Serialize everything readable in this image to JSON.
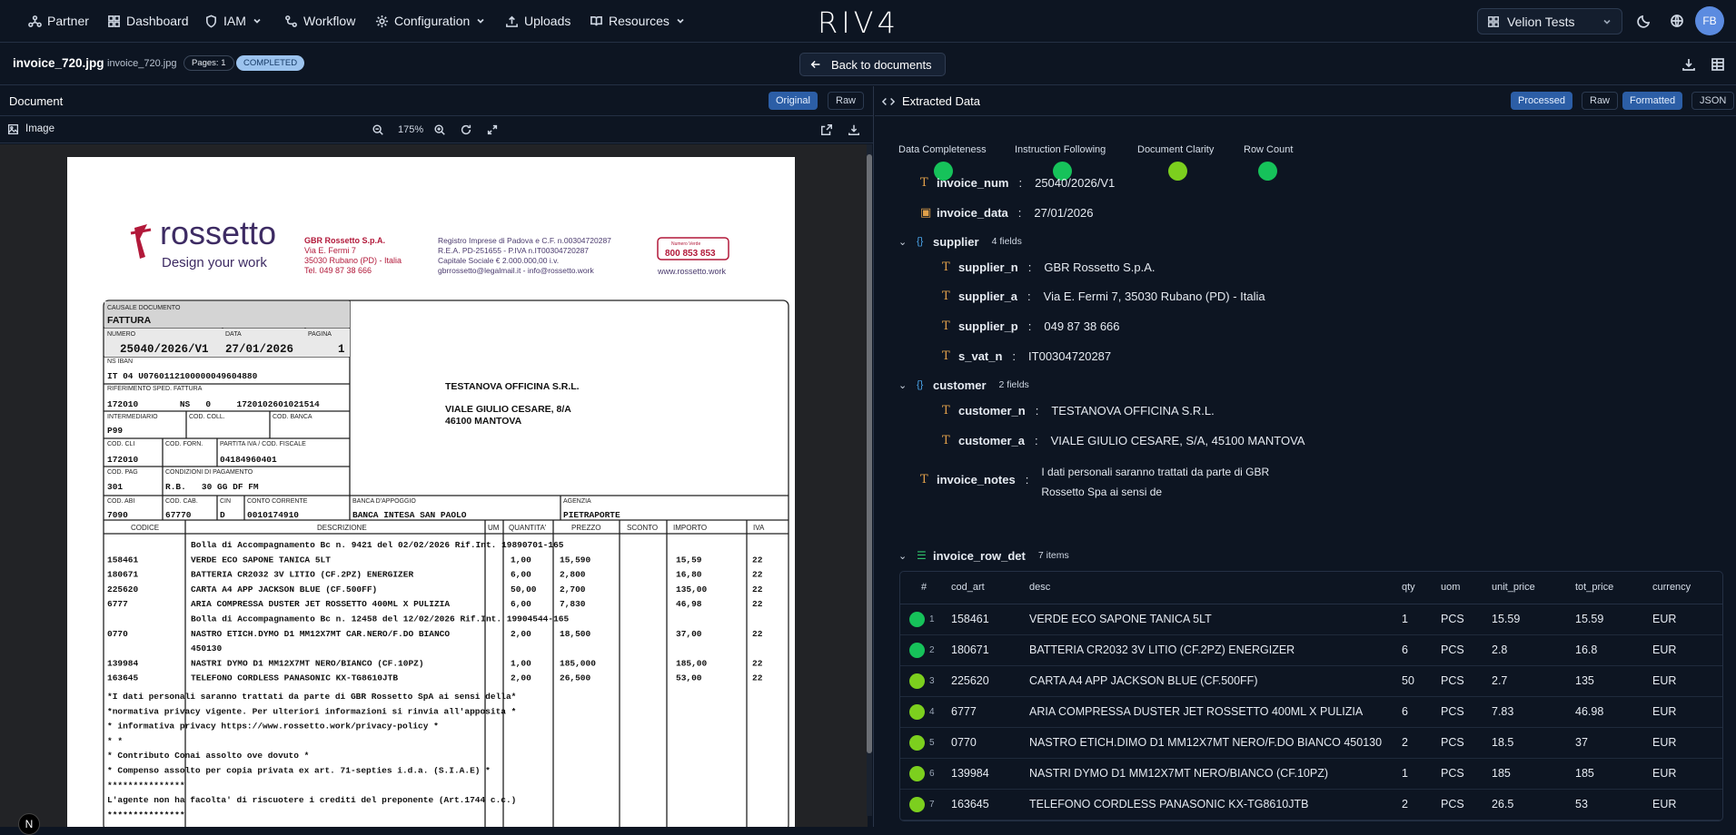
{
  "nav": {
    "items": [
      {
        "label": "Partner",
        "icon": "partner-icon",
        "has_dropdown": false
      },
      {
        "label": "Dashboard",
        "icon": "dashboard-icon",
        "has_dropdown": false
      },
      {
        "label": "IAM",
        "icon": "shield-icon",
        "has_dropdown": true
      },
      {
        "label": "Workflow",
        "icon": "workflow-icon",
        "has_dropdown": false
      },
      {
        "label": "Configuration",
        "icon": "gear-icon",
        "has_dropdown": true
      },
      {
        "label": "Uploads",
        "icon": "upload-icon",
        "has_dropdown": false
      },
      {
        "label": "Resources",
        "icon": "book-icon",
        "has_dropdown": true
      }
    ],
    "logo": "RIV4",
    "workspace": "Velion Tests",
    "avatar": "FB"
  },
  "doc": {
    "file_name": "invoice_720.jpg",
    "file_name_small": "invoice_720.jpg",
    "pages": "Pages: 1",
    "status": "COMPLETED",
    "back": "Back to documents"
  },
  "left": {
    "title": "Document",
    "toggles": [
      "Original",
      "Raw"
    ],
    "image_label": "Image",
    "zoom": "175%"
  },
  "right": {
    "title": "Extracted Data",
    "toggles_a": [
      "Processed",
      "Raw"
    ],
    "toggles_b": [
      "Formatted",
      "JSON"
    ],
    "scores": [
      {
        "label": "Data Completeness",
        "color": "#16c25a"
      },
      {
        "label": "Instruction Following",
        "color": "#16c25a"
      },
      {
        "label": "Document Clarity",
        "color": "#7ccf1e"
      },
      {
        "label": "Row Count",
        "color": "#16c25a"
      }
    ],
    "fields": {
      "invoice_num": {
        "k": "invoice_num",
        "v": "25040/2026/V1"
      },
      "invoice_data": {
        "k": "invoice_data",
        "v": "27/01/2026"
      },
      "supplier": {
        "k": "supplier",
        "count": "4 fields"
      },
      "supplier_n": {
        "k": "supplier_n",
        "v": "GBR Rossetto S.p.A."
      },
      "supplier_a": {
        "k": "supplier_a",
        "v": "Via E. Fermi 7, 35030 Rubano (PD) - Italia"
      },
      "supplier_p": {
        "k": "supplier_p",
        "v": "049 87 38 666"
      },
      "s_vat_n": {
        "k": "s_vat_n",
        "v": "IT00304720287"
      },
      "customer": {
        "k": "customer",
        "count": "2 fields"
      },
      "customer_n": {
        "k": "customer_n",
        "v": "TESTANOVA OFFICINA S.R.L."
      },
      "customer_a": {
        "k": "customer_a",
        "v": "VIALE GIULIO CESARE, S/A, 45100 MANTOVA"
      },
      "invoice_notes": {
        "k": "invoice_notes",
        "v1": "I dati personali saranno trattati da parte di GBR",
        "v2": "Rossetto Spa ai sensi de"
      },
      "rows": {
        "k": "invoice_row_det",
        "count": "7 items"
      }
    },
    "table": {
      "headers": [
        "#",
        "cod_art",
        "desc",
        "qty",
        "uom",
        "unit_price",
        "tot_price",
        "currency"
      ],
      "rows": [
        {
          "n": "1",
          "dot": "#16c25a",
          "cod": "158461",
          "desc": "VERDE ECO SAPONE TANICA 5LT",
          "qty": "1",
          "uom": "PCS",
          "up": "15.59",
          "tp": "15.59",
          "cur": "EUR"
        },
        {
          "n": "2",
          "dot": "#16c25a",
          "cod": "180671",
          "desc": "BATTERIA CR2032 3V LITIO (CF.2PZ) ENERGIZER",
          "qty": "6",
          "uom": "PCS",
          "up": "2.8",
          "tp": "16.8",
          "cur": "EUR"
        },
        {
          "n": "3",
          "dot": "#7ccf1e",
          "cod": "225620",
          "desc": "CARTA A4 APP JACKSON BLUE (CF.500FF)",
          "qty": "50",
          "uom": "PCS",
          "up": "2.7",
          "tp": "135",
          "cur": "EUR"
        },
        {
          "n": "4",
          "dot": "#7ccf1e",
          "cod": "6777",
          "desc": "ARIA COMPRESSA DUSTER JET ROSSETTO 400ML X PULIZIA",
          "qty": "6",
          "uom": "PCS",
          "up": "7.83",
          "tp": "46.98",
          "cur": "EUR"
        },
        {
          "n": "5",
          "dot": "#7ccf1e",
          "cod": "0770",
          "desc": "NASTRO ETICH.DIMO D1 MM12X7MT NERO/F.DO BIANCO 450130",
          "qty": "2",
          "uom": "PCS",
          "up": "18.5",
          "tp": "37",
          "cur": "EUR"
        },
        {
          "n": "6",
          "dot": "#7ccf1e",
          "cod": "139984",
          "desc": "NASTRI DYMO D1 MM12X7MT NERO/BIANCO (CF.10PZ)",
          "qty": "1",
          "uom": "PCS",
          "up": "185",
          "tp": "185",
          "cur": "EUR"
        },
        {
          "n": "7",
          "dot": "#7ccf1e",
          "cod": "163645",
          "desc": "TELEFONO CORDLESS PANASONIC KX-TG8610JTB",
          "qty": "2",
          "uom": "PCS",
          "up": "26.5",
          "tp": "53",
          "cur": "EUR"
        }
      ]
    }
  },
  "invoice_image": {
    "brand": "rossetto",
    "tagline": "Design your work",
    "company_block": [
      "GBR Rossetto S.p.A.",
      "Via E. Fermi 7",
      "35030 Rubano (PD) - Italia",
      "Tel. 049 87 38 666"
    ],
    "registry_block": [
      "Registro Imprese di Padova e C.F. n.00304720287",
      "R.E.A. PD-251655 - P.IVA n.IT00304720287",
      "Capitale Sociale € 2.000.000,00 i.v.",
      "gbrrossetto@legalmail.it - info@rossetto.work"
    ],
    "green_number_label": "Numero Verde",
    "green_number": "800 853 853",
    "website": "www.rossetto.work",
    "causale_label": "CAUSALE DOCUMENTO",
    "causale": "FATTURA",
    "numero_label": "NUMERO",
    "numero": "25040/2026/V1",
    "data_label": "DATA",
    "data": "27/01/2026",
    "pagina_label": "PAGINA",
    "pagina": "1",
    "iban_label": "NS IBAN",
    "iban": "IT 04 U0760112100000049604880",
    "rif_label": "RIFERIMENTO SPED. FATTURA",
    "rif": "172010        NS   0     1720102601021514",
    "intermediario_label": "INTERMEDIARIO",
    "intermediario": "P99",
    "cod_coll_label": "COD. COLL.",
    "cod_banca_label": "COD. BANCA",
    "cod_cli_label": "COD. CLI",
    "cod_cli": "172010",
    "cod_forn_label": "COD. FORN.",
    "piva_label": "PARTITA IVA / COD. FISCALE",
    "piva": "04184960401",
    "cod_pag_label": "COD. PAG",
    "cod_pag": "301",
    "cond_label": "CONDIZIONI DI PAGAMENTO",
    "cond": "R.B.   30 GG DF FM",
    "customer_name": "TESTANOVA OFFICINA S.R.L.",
    "customer_addr1": "VIALE GIULIO CESARE, 8/A",
    "customer_addr2": "46100 MANTOVA",
    "abi_label": "COD. ABI",
    "abi": "7090",
    "cab_label": "COD. CAB.",
    "cab": "67770",
    "cin_label": "CIN",
    "cin": "D",
    "cc_label": "CONTO CORRENTE",
    "cc": "0010174910",
    "banca_label": "BANCA D'APPOGGIO",
    "banca": "BANCA INTESA SAN PAOLO",
    "agenzia_label": "AGENZIA",
    "agenzia": "PIETRAPORTE",
    "cols": [
      "CODICE",
      "DESCRIZIONE",
      "UM",
      "QUANTITA'",
      "PREZZO",
      "SCONTO",
      "IMPORTO",
      "IVA"
    ],
    "lines": [
      {
        "c": "",
        "d": "Bolla di Accompagnamento   Bc n.   9421 del 02/02/2026 Rif.Int.  19890701-165",
        "q": "",
        "p": "",
        "i": "",
        "v": ""
      },
      {
        "c": "158461",
        "d": "VERDE ECO SAPONE TANICA 5LT",
        "q": "1,00",
        "p": "15,590",
        "i": "15,59",
        "v": "22"
      },
      {
        "c": "180671",
        "d": "BATTERIA CR2032 3V LITIO (CF.2PZ) ENERGIZER",
        "q": "6,00",
        "p": "2,800",
        "i": "16,80",
        "v": "22"
      },
      {
        "c": "225620",
        "d": "CARTA A4 APP JACKSON BLUE (CF.500FF)",
        "q": "50,00",
        "p": "2,700",
        "i": "135,00",
        "v": "22"
      },
      {
        "c": "6777",
        "d": "ARIA COMPRESSA DUSTER JET ROSSETTO 400ML X PULIZIA",
        "q": "6,00",
        "p": "7,830",
        "i": "46,98",
        "v": "22"
      },
      {
        "c": "",
        "d": "Bolla di Accompagnamento   Bc n.  12458 del 12/02/2026 Rif.Int.  19904544-165",
        "q": "",
        "p": "",
        "i": "",
        "v": ""
      },
      {
        "c": "0770",
        "d": "NASTRO ETICH.DYMO D1 MM12X7MT CAR.NERO/F.DO BIANCO",
        "q": "2,00",
        "p": "18,500",
        "i": "37,00",
        "v": "22"
      },
      {
        "c": "",
        "d": "450130",
        "q": "",
        "p": "",
        "i": "",
        "v": ""
      },
      {
        "c": "139984",
        "d": "NASTRI DYMO D1 MM12X7MT NERO/BIANCO (CF.10PZ)",
        "q": "1,00",
        "p": "185,000",
        "i": "185,00",
        "v": "22"
      },
      {
        "c": "163645",
        "d": "TELEFONO CORDLESS PANASONIC KX-TG8610JTB",
        "q": "2,00",
        "p": "26,500",
        "i": "53,00",
        "v": "22"
      }
    ],
    "notes": [
      "*I dati personali saranno trattati da parte di GBR Rossetto SpA ai sensi della*",
      "*normativa privacy vigente. Per ulteriori informazioni si rinvia all'apposita *",
      "*      informativa privacy https://www.rossetto.work/privacy-policy           *",
      "*                                                                              *",
      "*          Contributo Conai assolto ove dovuto                                *",
      "* Compenso assolto per copia privata ex art. 71-septies i.d.a. (S.I.A.E)      *",
      "                       ***************",
      "L'agente non ha facolta' di riscuotere i crediti del preponente (Art.1744 c.c.)",
      "                       ***************"
    ]
  }
}
